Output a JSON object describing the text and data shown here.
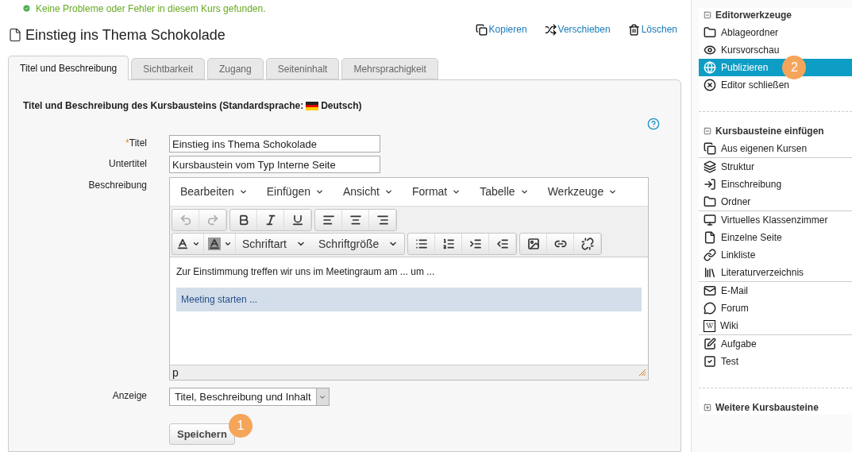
{
  "status_message": "Keine Probleme oder Fehler in diesem Kurs gefunden.",
  "page_title": "Einstieg ins Thema Schokolade",
  "actions": [
    {
      "kind": "copy",
      "label": "Kopieren"
    },
    {
      "kind": "move",
      "label": "Verschieben"
    },
    {
      "kind": "delete",
      "label": "Löschen"
    }
  ],
  "tabs": [
    {
      "label": "Titel und Beschreibung",
      "selected": true
    },
    {
      "label": "Sichtbarkeit",
      "selected": false
    },
    {
      "label": "Zugang",
      "selected": false
    },
    {
      "label": "Seiteninhalt",
      "selected": false
    },
    {
      "label": "Mehrsprachigkeit",
      "selected": false
    }
  ],
  "form": {
    "heading": "Titel und Beschreibung des Kursbausteins (Standardsprache:",
    "language": "Deutsch)",
    "fields": [
      {
        "label": "Titel",
        "required_mark": "*",
        "value": "Einstieg ins Thema Schokolade"
      },
      {
        "label": "Untertitel",
        "value": "Kursbaustein vom Typ Interne Seite"
      }
    ],
    "editor": {
      "label": "Beschreibung",
      "menus": [
        "Bearbeiten",
        "Einfügen",
        "Ansicht",
        "Format",
        "Tabelle",
        "Werkzeuge"
      ],
      "toolbar_rows": [
        [
          [
            {
              "kind": "undo",
              "disabled": true
            },
            {
              "kind": "redo",
              "disabled": true
            }
          ],
          [
            {
              "kind": "bold",
              "disabled": false
            },
            {
              "kind": "italic",
              "disabled": false
            },
            {
              "kind": "underline",
              "disabled": false
            }
          ],
          [
            {
              "kind": "align-left",
              "disabled": false
            },
            {
              "kind": "align-center",
              "disabled": false
            },
            {
              "kind": "align-right",
              "disabled": false
            }
          ]
        ],
        [
          [
            {
              "kind": "text-color",
              "disabled": false
            },
            {
              "kind": "background-color",
              "disabled": false
            },
            {
              "kind": "dropdown",
              "label": "Schriftart",
              "disabled": false
            },
            {
              "kind": "dropdown",
              "label": "Schriftgröße",
              "disabled": false
            }
          ],
          [
            {
              "kind": "bullet-list",
              "disabled": false
            },
            {
              "kind": "numbered-list",
              "disabled": false
            },
            {
              "kind": "indent",
              "disabled": false
            },
            {
              "kind": "outdent",
              "disabled": false
            }
          ],
          [
            {
              "kind": "image",
              "disabled": false
            },
            {
              "kind": "link",
              "disabled": false
            },
            {
              "kind": "unlink",
              "disabled": false
            }
          ]
        ]
      ],
      "paragraph": "Zur Einstimmung treffen wir uns im Meetingraum am ... um ...",
      "meeting_block": "Meeting starten ...",
      "path": "p"
    },
    "display": {
      "label": "Anzeige",
      "value": "Titel, Beschreibung und Inhalt"
    },
    "save_button": "Speichern",
    "save_badge": "1"
  },
  "sidebar": [
    {
      "title": "Editorwerkzeuge",
      "expanded": true,
      "groups": [
        [
          {
            "kind": "folder",
            "label": "Ablageordner",
            "selected": false
          },
          {
            "kind": "eye",
            "label": "Kursvorschau",
            "selected": false
          },
          {
            "kind": "globe",
            "label": "Publizieren",
            "selected": true,
            "badge": "2"
          },
          {
            "kind": "close",
            "label": "Editor schließen",
            "selected": false
          }
        ]
      ]
    },
    {
      "title": "Kursbausteine einfügen",
      "expanded": true,
      "groups": [
        [
          {
            "kind": "copy",
            "label": "Aus eigenen Kursen",
            "selected": false
          }
        ],
        [
          {
            "kind": "layers",
            "label": "Struktur",
            "selected": false
          },
          {
            "kind": "enroll",
            "label": "Einschreibung",
            "selected": false
          },
          {
            "kind": "folder",
            "label": "Ordner",
            "selected": false
          }
        ],
        [
          {
            "kind": "monitor",
            "label": "Virtuelles Klassenzimmer",
            "selected": false
          },
          {
            "kind": "page",
            "label": "Einzelne Seite",
            "selected": false
          },
          {
            "kind": "link",
            "label": "Linkliste",
            "selected": false
          },
          {
            "kind": "library",
            "label": "Literaturverzeichnis",
            "selected": false
          }
        ],
        [
          {
            "kind": "mail",
            "label": "E-Mail",
            "selected": false
          },
          {
            "kind": "forum",
            "label": "Forum",
            "selected": false
          },
          {
            "kind": "wiki",
            "label": "Wiki",
            "selected": false
          }
        ],
        [
          {
            "kind": "task",
            "label": "Aufgabe",
            "selected": false
          },
          {
            "kind": "test",
            "label": "Test",
            "selected": false
          }
        ]
      ]
    },
    {
      "title": "Weitere Kursbausteine",
      "expanded": false
    }
  ]
}
